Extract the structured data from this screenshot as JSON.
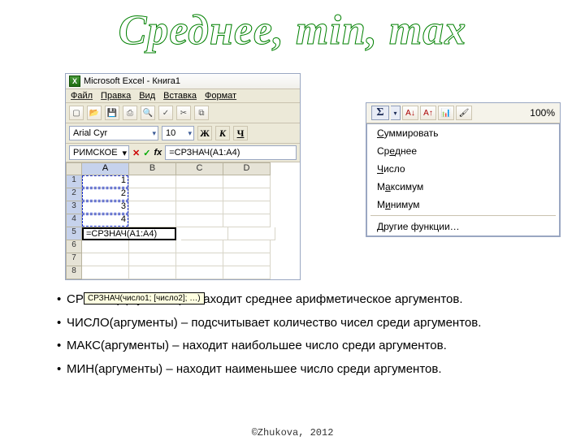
{
  "title": "Среднее, min, max",
  "excel": {
    "window_title": "Microsoft Excel - Книга1",
    "menu": [
      "Файл",
      "Правка",
      "Вид",
      "Вставка",
      "Формат"
    ],
    "font_name": "Arial Cyr",
    "font_size": "10",
    "format_buttons": {
      "bold": "Ж",
      "italic": "К",
      "underline": "Ч"
    },
    "namebox": "РИМСКОЕ",
    "formula": "=СРЗНАЧ(A1:A4)",
    "columns": [
      "A",
      "B",
      "C",
      "D"
    ],
    "rows": [
      "1",
      "2",
      "3",
      "4",
      "5",
      "6",
      "7",
      "8"
    ],
    "cells": {
      "A1": "1",
      "A2": "2",
      "A3": "3",
      "A4": "4",
      "A5": "=СРЗНАЧ(A1:A4)"
    },
    "tooltip": "СРЗНАЧ(число1; [число2]; …)"
  },
  "autosum": {
    "zoom": "100%",
    "menu": [
      "Суммировать",
      "Среднее",
      "Число",
      "Максимум",
      "Минимум",
      "Другие функции…"
    ],
    "menu_ul": [
      "С",
      "е",
      "Ч",
      "а",
      "и",
      "Д"
    ]
  },
  "bullets": [
    "СРЗНАЧ(аргументы) – находит среднее арифметическое аргументов.",
    "ЧИСЛО(аргументы) – подсчитывает количество чисел среди аргументов.",
    "МАКС(аргументы) – находит наибольшее число среди аргументов.",
    "МИН(аргументы) – находит наименьшее число среди аргументов."
  ],
  "copyright": "©Zhukova, 2012"
}
